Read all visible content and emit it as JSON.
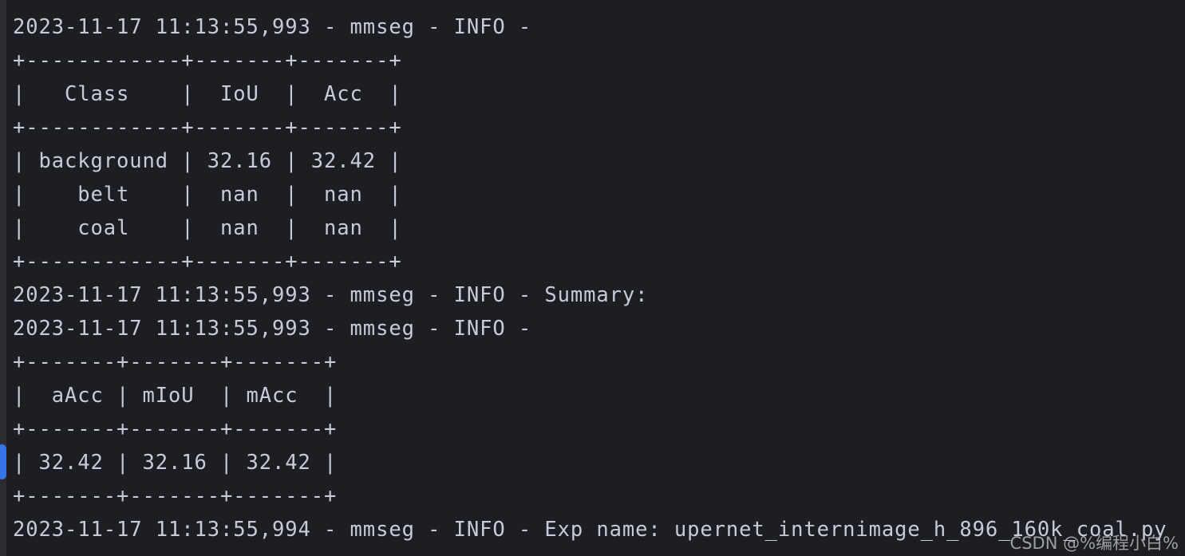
{
  "terminal": {
    "background_color": "#1d1e23",
    "gutter_color": "#2a2c31",
    "text_color": "#c6ccd7",
    "scroll_thumb_color": "#3575e8"
  },
  "log": {
    "lines": [
      "2023-11-17 11:13:55,993 - mmseg - INFO - ",
      "+------------+-------+-------+",
      "|   Class    |  IoU  |  Acc  |",
      "+------------+-------+-------+",
      "| background | 32.16 | 32.42 |",
      "|    belt    |  nan  |  nan  |",
      "|    coal    |  nan  |  nan  |",
      "+------------+-------+-------+",
      "2023-11-17 11:13:55,993 - mmseg - INFO - Summary:",
      "2023-11-17 11:13:55,993 - mmseg - INFO - ",
      "+-------+-------+-------+",
      "|  aAcc | mIoU  | mAcc  |",
      "+-------+-------+-------+",
      "| 32.42 | 32.16 | 32.42 |",
      "+-------+-------+-------+",
      "2023-11-17 11:13:55,994 - mmseg - INFO - Exp name: upernet_internimage_h_896_160k_coal.py"
    ]
  },
  "evaluation": {
    "timestamp": "2023-11-17 11:13:55,993",
    "logger": "mmseg",
    "level": "INFO",
    "per_class_table": {
      "headers": [
        "Class",
        "IoU",
        "Acc"
      ],
      "rows": [
        [
          "background",
          "32.16",
          "32.42"
        ],
        [
          "belt",
          "nan",
          "nan"
        ],
        [
          "coal",
          "nan",
          "nan"
        ]
      ]
    },
    "summary_label": "Summary:",
    "summary_table": {
      "headers": [
        "aAcc",
        "mIoU",
        "mAcc"
      ],
      "rows": [
        [
          "32.42",
          "32.16",
          "32.42"
        ]
      ]
    },
    "exp_name_label": "Exp name:",
    "exp_name": "upernet_internimage_h_896_160k_coal.py",
    "exp_timestamp": "2023-11-17 11:13:55,994"
  },
  "watermark": {
    "text": "CSDN @%编程小白%"
  }
}
